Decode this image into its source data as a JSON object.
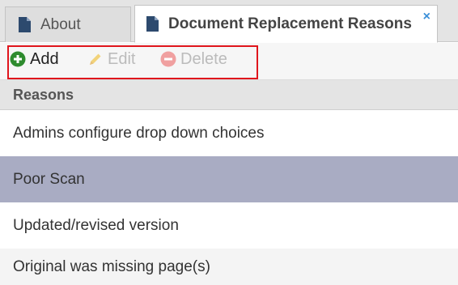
{
  "tabs": [
    {
      "label": "About",
      "icon": "document-icon"
    },
    {
      "label": "Document Replacement Reasons",
      "icon": "document-icon",
      "close": "×"
    }
  ],
  "toolbar": {
    "add_label": "Add",
    "edit_label": "Edit",
    "delete_label": "Delete",
    "add_icon": "plus-circle-icon",
    "edit_icon": "pencil-icon",
    "delete_icon": "minus-circle-icon"
  },
  "grid": {
    "header": "Reasons",
    "rows": [
      "Admins configure drop down choices",
      "Poor Scan",
      "Updated/revised version",
      "Original was missing page(s)"
    ],
    "selected_row": "Poor Scan"
  },
  "colors": {
    "add_icon": "#2e8b2e",
    "edit_icon": "#f2d37a",
    "delete_icon": "#f0a0a0",
    "close_icon": "#3a8fd8",
    "selected_row": "#a9acc3",
    "highlight_box": "#e0151c"
  }
}
